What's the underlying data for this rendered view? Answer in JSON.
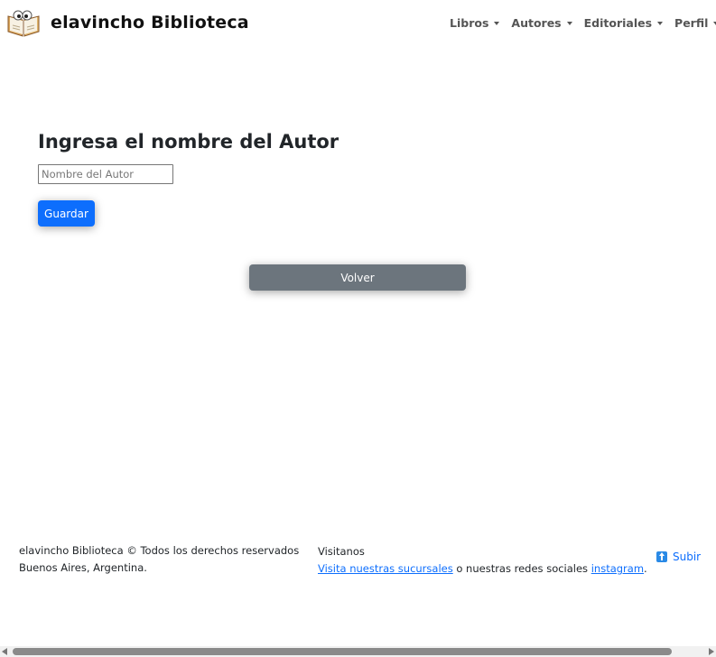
{
  "navbar": {
    "brand": "elavincho Biblioteca",
    "logo_icon": "open-book-logo",
    "menu": [
      {
        "label": "Libros"
      },
      {
        "label": "Autores"
      },
      {
        "label": "Editoriales"
      },
      {
        "label": "Perfil"
      }
    ]
  },
  "form": {
    "title": "Ingresa el nombre del Autor",
    "input_placeholder": "Nombre del Autor",
    "input_value": "",
    "save_label": "Guardar"
  },
  "back_label": "Volver",
  "footer": {
    "copyright": "elavincho Biblioteca © Todos los derechos reservados",
    "location": "Buenos Aires, Argentina.",
    "visit_heading": "Visitanos",
    "branches_link": "Visita nuestras sucursales",
    "social_text": " o nuestras redes sociales ",
    "instagram_link": "instagram",
    "period": ".",
    "up_label": "Subir"
  },
  "colors": {
    "primary": "#0d6efd",
    "secondary": "#6c757d",
    "link": "#0d6efd"
  }
}
